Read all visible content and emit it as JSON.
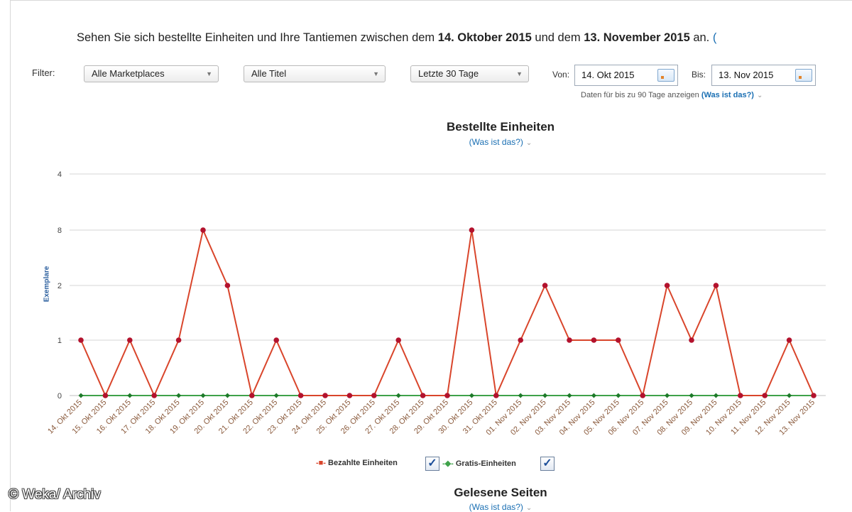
{
  "header": {
    "text_before": "Sehen Sie sich bestellte Einheiten und Ihre Tantiemen zwischen dem ",
    "date_from": "14. Oktober 2015",
    "text_middle": " und dem ",
    "date_to": "13. November 2015",
    "text_after": " an.",
    "trailing_paren": "("
  },
  "filters": {
    "label": "Filter:",
    "marketplace": "Alle Marketplaces",
    "title": "Alle Titel",
    "period": "Letzte 30 Tage",
    "from_label": "Von:",
    "from_value": "14. Okt 2015",
    "to_label": "Bis:",
    "to_value": "13. Nov 2015",
    "range_note": "Daten für bis zu 90 Tage anzeigen",
    "range_link": "(Was ist das?)"
  },
  "chart": {
    "title": "Bestellte Einheiten",
    "help_link": "(Was ist das?)",
    "ylabel": "Exemplare"
  },
  "legend": {
    "paid": "Bezahlte Einheiten",
    "free": "Gratis-Einheiten"
  },
  "section2": {
    "title": "Gelesene Seiten",
    "help_link": "(Was ist das?)"
  },
  "watermark": "© Weka/ Archiv",
  "colors": {
    "paid": "#d9452b",
    "paid_marker": "#b3122d",
    "free": "#3fa24a",
    "free_marker": "#1e7a2a",
    "grid": "#d6d6d6",
    "link": "#1a6fb3"
  },
  "chart_data": {
    "type": "line",
    "title": "Bestellte Einheiten",
    "xlabel": "",
    "ylabel": "Exemplare",
    "ylim": [
      0,
      4
    ],
    "y_ticks": [
      0,
      1,
      2,
      3,
      4
    ],
    "y_tick_labels": [
      "0",
      "1",
      "2",
      "8",
      "4"
    ],
    "grid": true,
    "legend": "bottom",
    "x": [
      "14. Okt 2015",
      "15. Okt 2015",
      "16. Okt 2015",
      "17. Okt 2015",
      "18. Okt 2015",
      "19. Okt 2015",
      "20. Okt 2015",
      "21. Okt 2015",
      "22. Okt 2015",
      "23. Okt 2015",
      "24. Okt 2015",
      "25. Okt 2015",
      "26. Okt 2015",
      "27. Okt 2015",
      "28. Okt 2015",
      "29. Okt 2015",
      "30. Okt 2015",
      "31. Okt 2015",
      "01. Nov 2015",
      "02. Nov 2015",
      "03. Nov 2015",
      "04. Nov 2015",
      "05. Nov 2015",
      "06. Nov 2015",
      "07. Nov 2015",
      "08. Nov 2015",
      "09. Nov 2015",
      "10. Nov 2015",
      "11. Nov 2015",
      "12. Nov 2015",
      "13. Nov 2015"
    ],
    "series": [
      {
        "name": "Bezahlte Einheiten",
        "values": [
          1,
          0,
          1,
          0,
          1,
          3,
          2,
          0,
          1,
          0,
          0,
          0,
          0,
          1,
          0,
          0,
          3,
          0,
          1,
          2,
          1,
          1,
          1,
          0,
          2,
          1,
          2,
          0,
          0,
          1,
          0
        ]
      },
      {
        "name": "Gratis-Einheiten",
        "values": [
          0,
          0,
          0,
          0,
          0,
          0,
          0,
          0,
          0,
          0,
          0,
          0,
          0,
          0,
          0,
          0,
          0,
          0,
          0,
          0,
          0,
          0,
          0,
          0,
          0,
          0,
          0,
          0,
          0,
          0,
          0
        ]
      }
    ]
  }
}
